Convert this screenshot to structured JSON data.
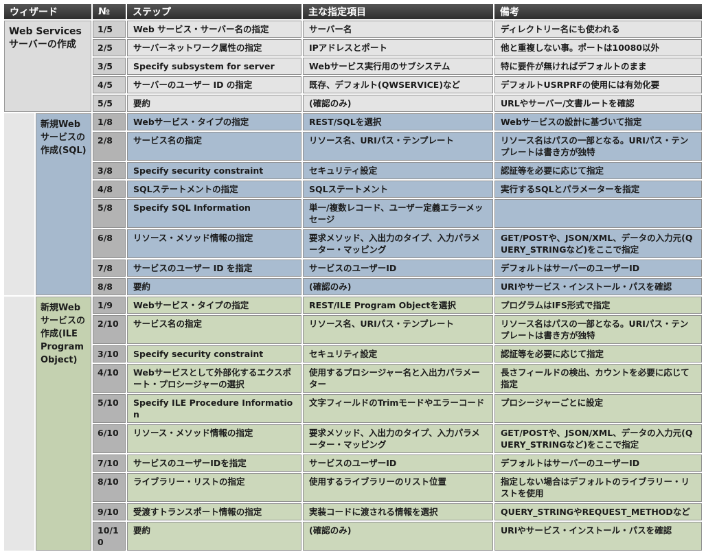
{
  "table": {
    "headers": [
      "ウィザード",
      "№",
      "ステップ",
      "主な指定項目",
      "備考"
    ],
    "groups": [
      {
        "label": "Web Services サーバーの作成",
        "rows": [
          {
            "no": "1/5",
            "step": "Web サービス・サーバー名の指定",
            "item": "サーバー名",
            "note": "ディレクトリー名にも使われる"
          },
          {
            "no": "2/5",
            "step": "サーバーネットワーク属性の指定",
            "item": "IPアドレスとポート",
            "note": "他と重複しない事。ポートは10080以外"
          },
          {
            "no": "3/5",
            "step": "Specify subsystem for server",
            "item": "Webサービス実行用のサブシステム",
            "note": "特に要件が無ければデフォルトのまま"
          },
          {
            "no": "4/5",
            "step": "サーバーのユーザー ID の指定",
            "item": "既存、デフォルト(QWSERVICE)など",
            "note": "デフォルトUSRPRFの使用には有効化要"
          },
          {
            "no": "5/5",
            "step": "要約",
            "item": "(確認のみ)",
            "note": "URLやサーバー/文書ルートを確認"
          }
        ]
      },
      {
        "label": "新規Webサービスの作成(SQL)",
        "rows": [
          {
            "no": "1/8",
            "step": "Webサービス・タイプの指定",
            "item": "REST/SQLを選択",
            "note": "Webサービスの設計に基づいて指定"
          },
          {
            "no": "2/8",
            "step": "サービス名の指定",
            "item": "リソース名、URIパス・テンプレート",
            "note": "リソース名はパスの一部となる。URIパス・テンプレートは書き方が独特"
          },
          {
            "no": "3/8",
            "step": "Specify security constraint",
            "item": "セキュリティ設定",
            "note": "認証等を必要に応じて指定"
          },
          {
            "no": "4/8",
            "step": "SQLステートメントの指定",
            "item": "SQLステートメント",
            "note": "実行するSQLとパラメーターを指定"
          },
          {
            "no": "5/8",
            "step": "Specify SQL Information",
            "item": "単一/複数レコード、ユーザー定義エラーメッセージ",
            "note": ""
          },
          {
            "no": "6/8",
            "step": "リソース・メソッド情報の指定",
            "item": "要求メソッド、入出力のタイプ、入力パラメーター・マッピング",
            "note": "GET/POSTや、JSON/XML、データの入力元(QUERY_STRINGなど)をここで指定"
          },
          {
            "no": "7/8",
            "step": "サービスのユーザー ID を指定",
            "item": "サービスのユーザーID",
            "note": "デフォルトはサーバーのユーザーID"
          },
          {
            "no": "8/8",
            "step": "要約",
            "item": "(確認のみ)",
            "note": "URIやサービス・インストール・パスを確認"
          }
        ]
      },
      {
        "label": "新規Webサービスの作成(ILE Program Object)",
        "rows": [
          {
            "no": "1/9",
            "step": "Webサービス・タイプの指定",
            "item": "REST/ILE Program Objectを選択",
            "note": "プログラムはIFS形式で指定"
          },
          {
            "no": "2/10",
            "step": "サービス名の指定",
            "item": "リソース名、URIパス・テンプレート",
            "note": "リソース名はパスの一部となる。URIパス・テンプレートは書き方が独特"
          },
          {
            "no": "3/10",
            "step": "Specify security constraint",
            "item": "セキュリティ設定",
            "note": "認証等を必要に応じて指定"
          },
          {
            "no": "4/10",
            "step": "Webサービスとして外部化するエクスポート・プロシージャーの選択",
            "item": "使用するプロシージャー名と入出力パラメーター",
            "note": "長さフィールドの検出、カウントを必要に応じて指定"
          },
          {
            "no": "5/10",
            "step": "Specify ILE Procedure Information",
            "item": "文字フィールドのTrimモードやエラーコード",
            "note": "プロシージャーごとに設定"
          },
          {
            "no": "6/10",
            "step": "リソース・メソッド情報の指定",
            "item": "要求メソッド、入出力のタイプ、入力パラメーター・マッピング",
            "note": "GET/POSTや、JSON/XML、データの入力元(QUERY_STRINGなど)をここで指定"
          },
          {
            "no": "7/10",
            "step": "サービスのユーザーIDを指定",
            "item": "サービスのユーザーID",
            "note": "デフォルトはサーバーのユーザーID"
          },
          {
            "no": "8/10",
            "step": "ライブラリー・リストの指定",
            "item": "使用するライブラリーのリスト位置",
            "note": "指定しない場合はデフォルトのライブラリー・リストを使用"
          },
          {
            "no": "9/10",
            "step": "受渡すトランスポート情報の指定",
            "item": "実装コードに渡される情報を選択",
            "note": "QUERY_STRINGやREQUEST_METHODなど"
          },
          {
            "no": "10/10",
            "step": "要約",
            "item": "(確認のみ)",
            "note": "URIやサービス・インストール・パスを確認"
          }
        ]
      }
    ]
  }
}
